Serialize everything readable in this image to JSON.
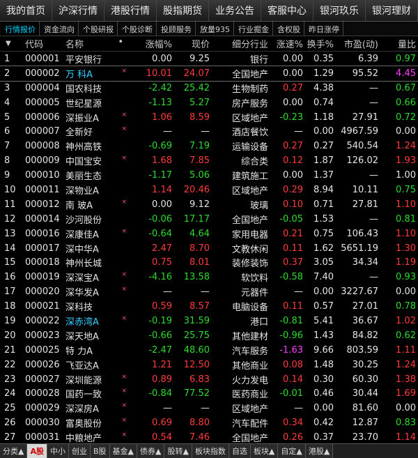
{
  "topnav": [
    "我的首页",
    "沪深行情",
    "港股行情",
    "股指期货",
    "业务公告",
    "客服中心",
    "银河玖乐",
    "银河理财"
  ],
  "subtabs": [
    "行情报价",
    "资金流向",
    "个股研报",
    "个股诊断",
    "投顾服务",
    "放量935",
    "行业掘金",
    "含权股",
    "昨日涨停"
  ],
  "columns": {
    "sort_arrow": "▼",
    "code": "代码",
    "name": "名称",
    "dot": "•",
    "change_pct": "涨幅%",
    "price": "现价",
    "industry": "细分行业",
    "speed": "涨速%",
    "turnover": "换手%",
    "pe": "市盈(动)",
    "vol_ratio": "量比"
  },
  "rows": [
    {
      "rank": "1",
      "code": "000001",
      "name": "平安银行",
      "tag": "",
      "chg": "0.00",
      "chgc": "flat",
      "price": "9.25",
      "pc": "flat",
      "ind": "银行",
      "spd": "0.00",
      "sc": "flat",
      "to": "0.35",
      "pe": "6.39",
      "vr": "0.97",
      "vc": "down"
    },
    {
      "rank": "2",
      "code": "000002",
      "name": "万 科A",
      "tag": "×",
      "chg": "10.01",
      "chgc": "up",
      "price": "24.07",
      "pc": "up",
      "ind": "全国地产",
      "spd": "0.00",
      "sc": "flat",
      "to": "1.29",
      "pe": "95.52",
      "vr": "4.45",
      "vc": "pink",
      "hl": true
    },
    {
      "rank": "3",
      "code": "000004",
      "name": "国农科技",
      "tag": "",
      "chg": "-2.42",
      "chgc": "down",
      "price": "25.42",
      "pc": "down",
      "ind": "生物制药",
      "spd": "0.27",
      "sc": "up",
      "to": "4.38",
      "pe": "—",
      "vr": "0.67",
      "vc": "down"
    },
    {
      "rank": "4",
      "code": "000005",
      "name": "世纪星源",
      "tag": "",
      "chg": "-1.13",
      "chgc": "down",
      "price": "5.27",
      "pc": "down",
      "ind": "房产服务",
      "spd": "0.00",
      "sc": "flat",
      "to": "0.74",
      "pe": "—",
      "vr": "0.66",
      "vc": "down"
    },
    {
      "rank": "5",
      "code": "000006",
      "name": "深振业A",
      "tag": "×",
      "chg": "1.06",
      "chgc": "up",
      "price": "8.59",
      "pc": "up",
      "ind": "区域地产",
      "spd": "-0.23",
      "sc": "down",
      "to": "1.18",
      "pe": "27.91",
      "vr": "0.72",
      "vc": "down"
    },
    {
      "rank": "6",
      "code": "000007",
      "name": "全新好",
      "tag": "×",
      "chg": "—",
      "chgc": "flat",
      "price": "—",
      "pc": "flat",
      "ind": "酒店餐饮",
      "spd": "—",
      "sc": "flat",
      "to": "0.00",
      "pe": "4967.59",
      "vr": "0.00",
      "vc": "flat"
    },
    {
      "rank": "7",
      "code": "000008",
      "name": "神州高铁",
      "tag": "",
      "chg": "-0.69",
      "chgc": "down",
      "price": "7.19",
      "pc": "down",
      "ind": "运输设备",
      "spd": "0.27",
      "sc": "up",
      "to": "0.27",
      "pe": "540.54",
      "vr": "1.24",
      "vc": "up"
    },
    {
      "rank": "8",
      "code": "000009",
      "name": "中国宝安",
      "tag": "×",
      "chg": "1.68",
      "chgc": "up",
      "price": "7.85",
      "pc": "up",
      "ind": "综合类",
      "spd": "0.12",
      "sc": "up",
      "to": "1.87",
      "pe": "126.02",
      "vr": "1.93",
      "vc": "up"
    },
    {
      "rank": "9",
      "code": "000010",
      "name": "美丽生态",
      "tag": "",
      "chg": "-1.17",
      "chgc": "down",
      "price": "5.06",
      "pc": "down",
      "ind": "建筑施工",
      "spd": "0.00",
      "sc": "flat",
      "to": "1.37",
      "pe": "—",
      "vr": "1.00",
      "vc": "flat"
    },
    {
      "rank": "10",
      "code": "000011",
      "name": "深物业A",
      "tag": "",
      "chg": "1.14",
      "chgc": "up",
      "price": "20.46",
      "pc": "up",
      "ind": "区域地产",
      "spd": "0.29",
      "sc": "up",
      "to": "8.94",
      "pe": "10.11",
      "vr": "0.75",
      "vc": "down"
    },
    {
      "rank": "11",
      "code": "000012",
      "name": "南 玻A",
      "tag": "×",
      "chg": "0.00",
      "chgc": "flat",
      "price": "9.12",
      "pc": "flat",
      "ind": "玻璃",
      "spd": "0.10",
      "sc": "up",
      "to": "0.71",
      "pe": "27.81",
      "vr": "1.10",
      "vc": "up"
    },
    {
      "rank": "12",
      "code": "000014",
      "name": "沙河股份",
      "tag": "",
      "chg": "-0.06",
      "chgc": "down",
      "price": "17.17",
      "pc": "down",
      "ind": "全国地产",
      "spd": "-0.05",
      "sc": "down",
      "to": "1.53",
      "pe": "—",
      "vr": "0.81",
      "vc": "down"
    },
    {
      "rank": "13",
      "code": "000016",
      "name": "深康佳A",
      "tag": "×",
      "chg": "-0.64",
      "chgc": "down",
      "price": "4.64",
      "pc": "down",
      "ind": "家用电器",
      "spd": "0.21",
      "sc": "up",
      "to": "0.75",
      "pe": "106.43",
      "vr": "1.10",
      "vc": "up"
    },
    {
      "rank": "14",
      "code": "000017",
      "name": "深中华A",
      "tag": "",
      "chg": "2.47",
      "chgc": "up",
      "price": "8.70",
      "pc": "up",
      "ind": "文教休闲",
      "spd": "0.11",
      "sc": "up",
      "to": "1.62",
      "pe": "5651.19",
      "vr": "1.30",
      "vc": "up"
    },
    {
      "rank": "15",
      "code": "000018",
      "name": "神州长城",
      "tag": "",
      "chg": "0.75",
      "chgc": "up",
      "price": "8.01",
      "pc": "up",
      "ind": "装修装饰",
      "spd": "0.37",
      "sc": "up",
      "to": "3.05",
      "pe": "34.34",
      "vr": "1.19",
      "vc": "up"
    },
    {
      "rank": "16",
      "code": "000019",
      "name": "深深宝A",
      "tag": "×",
      "chg": "-4.16",
      "chgc": "down",
      "price": "13.58",
      "pc": "down",
      "ind": "软饮料",
      "spd": "-0.58",
      "sc": "down",
      "to": "7.40",
      "pe": "—",
      "vr": "0.93",
      "vc": "down"
    },
    {
      "rank": "17",
      "code": "000020",
      "name": "深华发A",
      "tag": "×",
      "chg": "—",
      "chgc": "flat",
      "price": "—",
      "pc": "flat",
      "ind": "元器件",
      "spd": "—",
      "sc": "flat",
      "to": "0.00",
      "pe": "3227.67",
      "vr": "0.00",
      "vc": "flat"
    },
    {
      "rank": "18",
      "code": "000021",
      "name": "深科技",
      "tag": "",
      "chg": "0.59",
      "chgc": "up",
      "price": "8.57",
      "pc": "up",
      "ind": "电脑设备",
      "spd": "0.11",
      "sc": "up",
      "to": "0.57",
      "pe": "27.01",
      "vr": "0.78",
      "vc": "down"
    },
    {
      "rank": "19",
      "code": "000022",
      "name": "深赤湾A",
      "tag": "×",
      "chg": "-0.19",
      "chgc": "down",
      "price": "31.59",
      "pc": "down",
      "ind": "港口",
      "spd": "-0.81",
      "sc": "down",
      "to": "5.41",
      "pe": "36.67",
      "vr": "1.02",
      "vc": "up",
      "hl": true
    },
    {
      "rank": "20",
      "code": "000023",
      "name": "深天地A",
      "tag": "",
      "chg": "-0.66",
      "chgc": "down",
      "price": "25.75",
      "pc": "down",
      "ind": "其他建材",
      "spd": "-0.96",
      "sc": "down",
      "to": "1.43",
      "pe": "84.82",
      "vr": "0.62",
      "vc": "down"
    },
    {
      "rank": "21",
      "code": "000025",
      "name": "特 力A",
      "tag": "",
      "chg": "-2.47",
      "chgc": "down",
      "price": "48.60",
      "pc": "down",
      "ind": "汽车服务",
      "spd": "-1.63",
      "sc": "pink",
      "to": "9.66",
      "pe": "803.59",
      "vr": "1.11",
      "vc": "up"
    },
    {
      "rank": "22",
      "code": "000026",
      "name": "飞亚达A",
      "tag": "",
      "chg": "1.21",
      "chgc": "up",
      "price": "12.50",
      "pc": "up",
      "ind": "其他商业",
      "spd": "0.08",
      "sc": "up",
      "to": "1.48",
      "pe": "30.25",
      "vr": "1.24",
      "vc": "up"
    },
    {
      "rank": "23",
      "code": "000027",
      "name": "深圳能源",
      "tag": "×",
      "chg": "0.89",
      "chgc": "up",
      "price": "6.83",
      "pc": "up",
      "ind": "火力发电",
      "spd": "0.14",
      "sc": "up",
      "to": "0.30",
      "pe": "60.30",
      "vr": "1.38",
      "vc": "up"
    },
    {
      "rank": "24",
      "code": "000028",
      "name": "国药一致",
      "tag": "×",
      "chg": "-0.84",
      "chgc": "down",
      "price": "77.52",
      "pc": "down",
      "ind": "医药商业",
      "spd": "-0.01",
      "sc": "down",
      "to": "0.46",
      "pe": "30.44",
      "vr": "1.69",
      "vc": "up"
    },
    {
      "rank": "25",
      "code": "000029",
      "name": "深深房A",
      "tag": "×",
      "chg": "—",
      "chgc": "flat",
      "price": "—",
      "pc": "flat",
      "ind": "区域地产",
      "spd": "—",
      "sc": "flat",
      "to": "0.00",
      "pe": "81.60",
      "vr": "0.00",
      "vc": "flat"
    },
    {
      "rank": "26",
      "code": "000030",
      "name": "富奥股份",
      "tag": "×",
      "chg": "0.69",
      "chgc": "up",
      "price": "8.80",
      "pc": "up",
      "ind": "汽车配件",
      "spd": "0.34",
      "sc": "up",
      "to": "0.42",
      "pe": "12.87",
      "vr": "0.83",
      "vc": "down"
    },
    {
      "rank": "27",
      "code": "000031",
      "name": "中粮地产",
      "tag": "×",
      "chg": "0.54",
      "chgc": "up",
      "price": "7.46",
      "pc": "up",
      "ind": "全国地产",
      "spd": "0.26",
      "sc": "up",
      "to": "0.37",
      "pe": "23.70",
      "vr": "1.14",
      "vc": "up"
    }
  ],
  "bottom_tabs": [
    {
      "label": "分类▲",
      "active": false
    },
    {
      "label": "A股",
      "active": true
    },
    {
      "label": "中小",
      "active": false
    },
    {
      "label": "创业",
      "active": false
    },
    {
      "label": "B股",
      "active": false
    },
    {
      "label": "基金▲",
      "active": false
    },
    {
      "label": "债券▲",
      "active": false
    },
    {
      "label": "股转▲",
      "active": false
    },
    {
      "label": "板块指数",
      "active": false
    },
    {
      "label": "自选",
      "active": false
    },
    {
      "label": "板块▲",
      "active": false
    },
    {
      "label": "自定▲",
      "active": false
    },
    {
      "label": "港股▲",
      "active": false
    }
  ],
  "colors": {
    "up": "#ff3b3b",
    "down": "#2cdc2c",
    "flat": "#e6e6e6",
    "highlight": "#36d0ff",
    "accent_tab": "#00d7ff"
  }
}
